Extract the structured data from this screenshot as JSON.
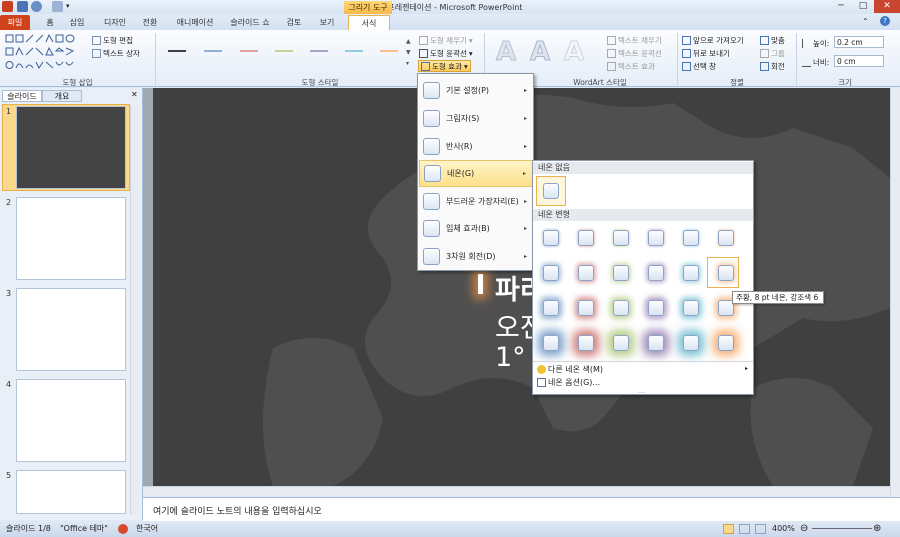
{
  "window": {
    "title": "새 프레젠테이션 - Microsoft PowerPoint",
    "tools_header": "그리기 도구",
    "min": "─",
    "max": "□",
    "close": "✕"
  },
  "tabs": [
    "파일",
    "홈",
    "삽입",
    "디자인",
    "전환",
    "애니메이션",
    "슬라이드 쇼",
    "검토",
    "보기",
    "서식"
  ],
  "ribbon": {
    "insert_shapes": {
      "edit_shape": "도형 편집",
      "text_box": "텍스트 상자",
      "label": "도형 삽입"
    },
    "shape_styles": {
      "label": "도형 스타일",
      "fill": "도형 채우기",
      "outline": "도형 윤곽선",
      "effects": "도형 효과"
    },
    "wordart": {
      "label": "WordArt 스타일",
      "text_fill": "텍스트 채우기",
      "text_outline": "텍스트 윤곽선",
      "text_effects": "텍스트 효과"
    },
    "arrange": {
      "label": "정렬",
      "bring_forward": "앞으로 가져오기",
      "send_backward": "뒤로 보내기",
      "selection_pane": "선택 창",
      "align": "맞춤",
      "group": "그룹",
      "rotate": "회전"
    },
    "size": {
      "label": "크기",
      "height_label": "높이:",
      "height_value": "0.2 cm",
      "width_label": "너비:",
      "width_value": "0 cm"
    }
  },
  "left_pane": {
    "tab_slides": "슬라이드",
    "tab_outline": "개요",
    "slide_numbers": [
      "1",
      "2",
      "3",
      "4",
      "5"
    ]
  },
  "slide": {
    "line1": "파리",
    "line2": "오전",
    "line3": "1°"
  },
  "effects_menu": {
    "items": [
      "기본 설정(P)",
      "그림자(S)",
      "반사(R)",
      "네온(G)",
      "부드러운 가장자리(E)",
      "입체 효과(B)",
      "3차원 회전(D)"
    ]
  },
  "glow_panel": {
    "no_glow_header": "네온 없음",
    "variations_header": "네온 변형",
    "more_colors": "다른 네온 색(M)",
    "options": "네온 옵션(G)..."
  },
  "glow_colors": [
    "#4f81bd",
    "#c0504d",
    "#9bbb59",
    "#8064a2",
    "#4bacc6",
    "#f79646"
  ],
  "tooltip": "주황, 8 pt 네온, 강조색 6",
  "notes": {
    "placeholder": "여기에 슬라이드 노트의 내용을 입력하십시오"
  },
  "status": {
    "slide_info": "슬라이드 1/8",
    "theme": "\"Office 테마\"",
    "language": "한국어",
    "zoom": "400%"
  }
}
